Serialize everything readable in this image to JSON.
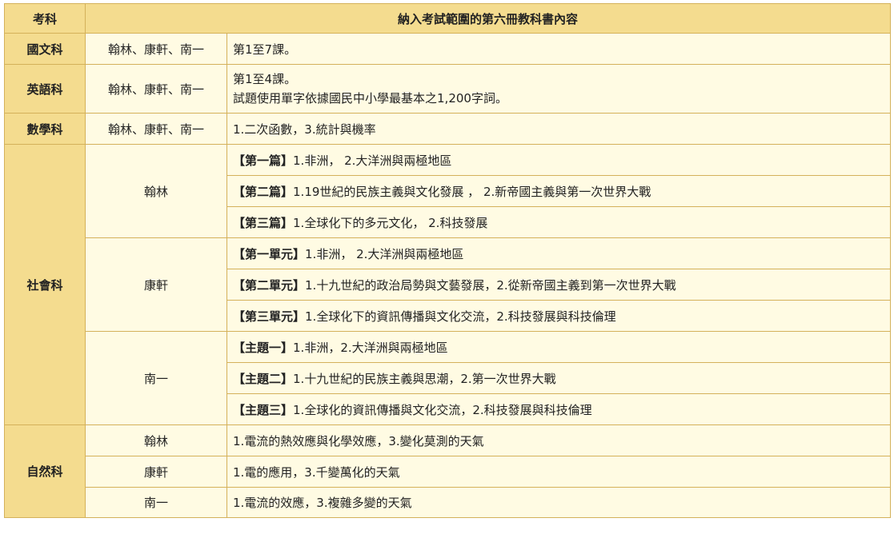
{
  "header": {
    "subject": "考科",
    "content": "納入考試範圍的第六冊教科書內容"
  },
  "rows": {
    "chinese": {
      "subject": "國文科",
      "publishers": "翰林、康軒、南一",
      "content": "第1至7課。"
    },
    "english": {
      "subject": "英語科",
      "publishers": "翰林、康軒、南一",
      "content_line1": "第1至4課。",
      "content_line2": "試題使用單字依據國民中小學最基本之1,200字詞。"
    },
    "math": {
      "subject": "數學科",
      "publishers": "翰林、康軒、南一",
      "content": "1.二次函數，3.統計與機率"
    },
    "social": {
      "subject": "社會科",
      "hanlin": {
        "publisher": "翰林",
        "items": [
          {
            "tag": "【第一篇】",
            "text": "1.非洲， 2.大洋洲與兩極地區"
          },
          {
            "tag": "【第二篇】",
            "text": "1.19世紀的民族主義與文化發展 ， 2.新帝國主義與第一次世界大戰"
          },
          {
            "tag": "【第三篇】",
            "text": "1.全球化下的多元文化， 2.科技發展"
          }
        ]
      },
      "kangxuan": {
        "publisher": "康軒",
        "items": [
          {
            "tag": "【第一單元】",
            "text": "1.非洲， 2.大洋洲與兩極地區"
          },
          {
            "tag": "【第二單元】",
            "text": "1.十九世紀的政治局勢與文藝發展，2.從新帝國主義到第一次世界大戰"
          },
          {
            "tag": "【第三單元】",
            "text": "1.全球化下的資訊傳播與文化交流，2.科技發展與科技倫理"
          }
        ]
      },
      "nanyi": {
        "publisher": "南一",
        "items": [
          {
            "tag": "【主題一】",
            "text": "1.非洲，2.大洋洲與兩極地區"
          },
          {
            "tag": "【主題二】",
            "text": "1.十九世紀的民族主義與思潮，2.第一次世界大戰"
          },
          {
            "tag": "【主題三】",
            "text": "1.全球化的資訊傳播與文化交流，2.科技發展與科技倫理"
          }
        ]
      }
    },
    "science": {
      "subject": "自然科",
      "hanlin": {
        "publisher": "翰林",
        "content": "1.電流的熱效應與化學效應，3.變化莫測的天氣"
      },
      "kangxuan": {
        "publisher": "康軒",
        "content": "1.電的應用，3.千變萬化的天氣"
      },
      "nanyi": {
        "publisher": "南一",
        "content": "1.電流的效應，3.複雜多變的天氣"
      }
    }
  }
}
